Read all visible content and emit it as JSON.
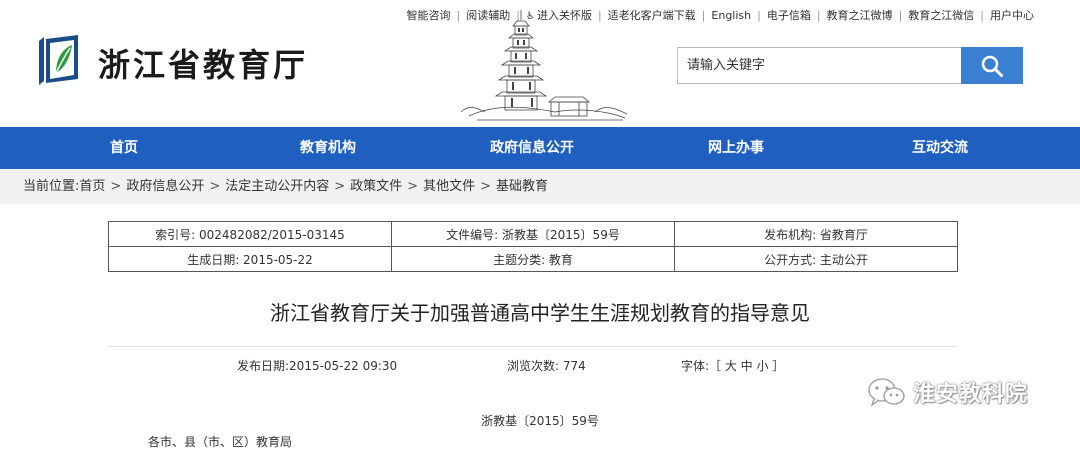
{
  "top_links": [
    "智能咨询",
    "阅读辅助",
    "进入关怀版",
    "适老化客户端下载",
    "English",
    "电子信箱",
    "教育之江微博",
    "教育之江微信",
    "用户中心"
  ],
  "site": {
    "title": "浙江省教育厅"
  },
  "search": {
    "placeholder": "请输入关键字"
  },
  "nav": [
    "首页",
    "教育机构",
    "政府信息公开",
    "网上办事",
    "互动交流"
  ],
  "breadcrumb": {
    "prefix": "当前位置:",
    "items": [
      "首页",
      "政府信息公开",
      "法定主动公开内容",
      "政策文件",
      "其他文件",
      "基础教育"
    ]
  },
  "meta": {
    "index_no": "索引号: 002482082/2015-03145",
    "file_no": "文件编号: 浙教基〔2015〕59号",
    "publisher": "发布机构: 省教育厅",
    "created": "生成日期: 2015-05-22",
    "topic": "主题分类: 教育",
    "disclosure": "公开方式: 主动公开"
  },
  "article": {
    "title": "浙江省教育厅关于加强普通高中学生生涯规划教育的指导意见",
    "publish_date": "发布日期:2015-05-22 09:30",
    "views": "浏览次数: 774",
    "font_label": "字体:［ 大 中 小 ］",
    "doc_number": "浙教基〔2015〕59号",
    "cut_line": "各市、县（市、区）教育局"
  },
  "watermark": {
    "text": "淮安教科院"
  }
}
